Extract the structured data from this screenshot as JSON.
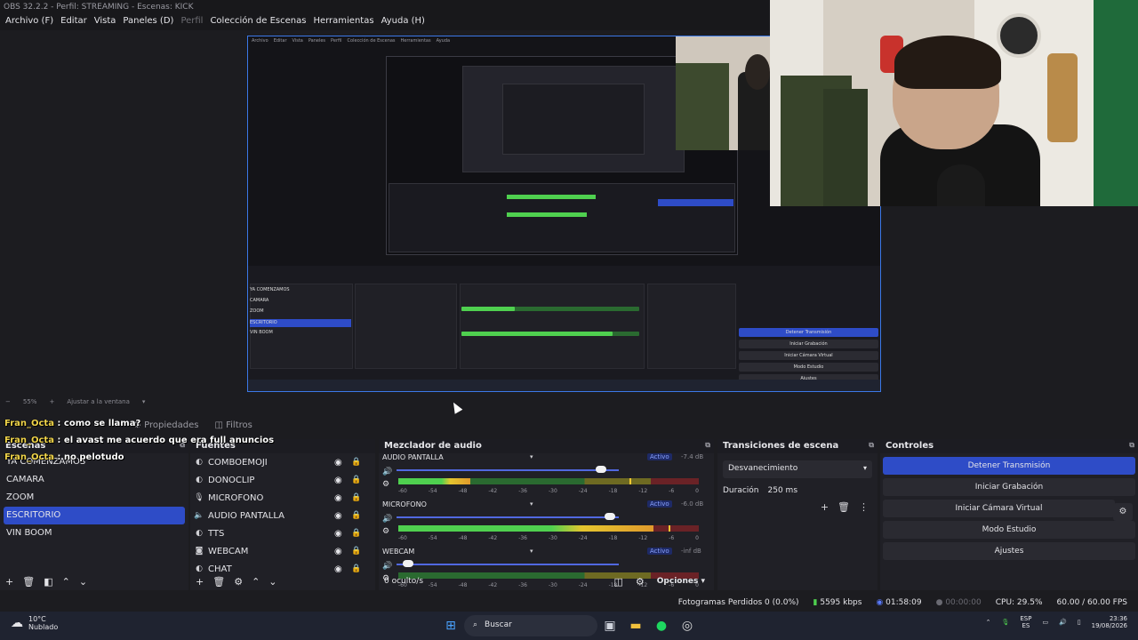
{
  "window": {
    "title": "OBS 32.2.2 - Perfil: STREAMING - Escenas: KICK"
  },
  "menu": [
    {
      "label": "Archivo (F)"
    },
    {
      "label": "Editar"
    },
    {
      "label": "Vista"
    },
    {
      "label": "Paneles (D)"
    },
    {
      "label": "Perfil",
      "disabled": true
    },
    {
      "label": "Colección de Escenas"
    },
    {
      "label": "Herramientas"
    },
    {
      "label": "Ayuda (H)"
    }
  ],
  "preview": {
    "zoom": "55%",
    "fit_label": "Ajustar a la ventana"
  },
  "tabs": {
    "properties": "Propiedades",
    "filters": "Filtros"
  },
  "chat": {
    "line1_user": "Fran_Octa",
    "line1_text": " : como se llama?",
    "line2_user": "Fran_Octa",
    "line2_text": " : el avast me acuerdo que era full anuncios",
    "line3_user": "Fran_Octa",
    "line3_text": " : no pelotudo"
  },
  "scenes": {
    "title": "Escenas",
    "items": [
      "YA COMENZAMOS",
      "CAMARA",
      "ZOOM",
      "ESCRITORIO",
      "VIN BOOM"
    ],
    "selected": "ESCRITORIO"
  },
  "sources": {
    "title": "Fuentes",
    "items": [
      {
        "name": "COMBOEMOJI",
        "icon": "browser-icon"
      },
      {
        "name": "DONOCLIP",
        "icon": "browser-icon"
      },
      {
        "name": "MICROFONO",
        "icon": "mic-icon"
      },
      {
        "name": "AUDIO PANTALLA",
        "icon": "speaker-icon"
      },
      {
        "name": "TTS",
        "icon": "browser-icon"
      },
      {
        "name": "WEBCAM",
        "icon": "camera-icon"
      },
      {
        "name": "CHAT",
        "icon": "browser-icon"
      }
    ]
  },
  "mixer": {
    "title": "Mezclador de audio",
    "channels": [
      {
        "name": "AUDIO PANTALLA",
        "status": "Activo",
        "db": "-7.4 dB",
        "slider": 0.92,
        "level": 0.24,
        "peak": 0.77
      },
      {
        "name": "MICROFONO",
        "status": "Activo",
        "db": "-6.0 dB",
        "slider": 0.96,
        "level": 0.85,
        "peak": 0.9
      },
      {
        "name": "WEBCAM",
        "status": "Activo",
        "db": "-inf dB",
        "slider": 0.05,
        "level": 0,
        "peak": 0
      }
    ],
    "scale": [
      "-60",
      "-54",
      "-48",
      "-42",
      "-36",
      "-30",
      "-24",
      "-18",
      "-12",
      "-6",
      "0"
    ],
    "hidden": "0 oculto/s",
    "options": "Opciones"
  },
  "transitions": {
    "title": "Transiciones de escena",
    "type": "Desvanecimiento",
    "duration_label": "Duración",
    "duration_value": "250 ms"
  },
  "controls": {
    "title": "Controles",
    "buttons": [
      {
        "label": "Detener Transmisión",
        "active": true
      },
      {
        "label": "Iniciar Grabación"
      },
      {
        "label": "Iniciar Cámara Virtual"
      },
      {
        "label": "Modo Estudio"
      },
      {
        "label": "Ajustes"
      }
    ]
  },
  "status": {
    "dropped": "Fotogramas Perdidos 0 (0.0%)",
    "bitrate": "5595 kbps",
    "stream_time": "01:58:09",
    "rec_time": "00:00:00",
    "cpu": "CPU: 29.5%",
    "fps": "60.00 / 60.00 FPS"
  },
  "taskbar": {
    "temp": "10°C",
    "weather": "Nublado",
    "search": "Buscar",
    "lang1": "ESP",
    "lang2": "ES",
    "time": "23:36",
    "date": "19/08/2026"
  },
  "colors": {
    "accent": "#2e4cc7",
    "preview_border": "#3b78e7",
    "meter_green": "#4fd04f",
    "meter_yellow": "#e4c52e",
    "meter_red": "#c8323a"
  }
}
